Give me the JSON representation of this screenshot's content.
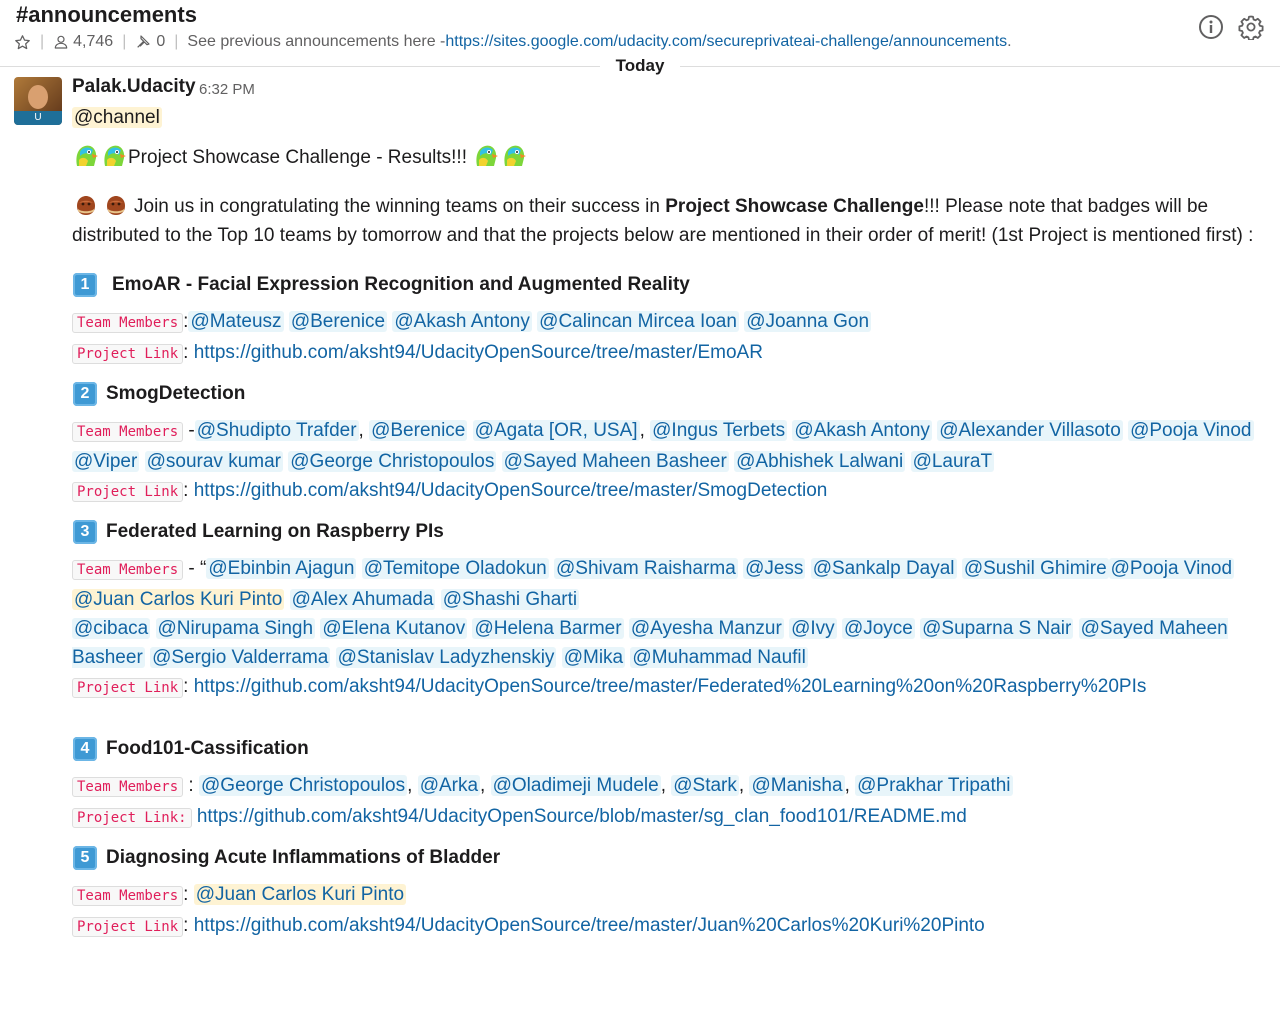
{
  "header": {
    "channel_name": "#announcements",
    "member_count": "4,746",
    "pinned_count": "0",
    "topic_text": "See previous announcements here - ",
    "topic_link": "https://sites.google.com/udacity.com/secureprivateai-challenge/announcements",
    "topic_suffix": ".",
    "icons": [
      "star-icon",
      "person-icon",
      "pin-icon",
      "info-icon",
      "gear-icon"
    ]
  },
  "day_divider": "Today",
  "message": {
    "sender": "Palak.Udacity",
    "time": "6:32 PM",
    "channel_mention": "@channel",
    "heading": "Project Showcase Challenge - Results!!!",
    "intro_before": "Join us in congratulating the winning teams on their success in ",
    "intro_bold": "Project Showcase Challenge",
    "intro_after": "!!! Please note that badges will be distributed to the Top 10 teams by tomorrow and that the projects below are mentioned in their order of merit! (1st Project is mentioned first) :",
    "team_label": "Team Members",
    "link_label": "Project Link",
    "link_label_colon": "Project Link:",
    "projects": [
      {
        "number": "1",
        "title": "EmoAR - Facial Expression Recognition and Augmented Reality",
        "members": [
          "@Mateusz",
          "@Berenice",
          "@Akash Antony",
          "@Calincan Mircea Ioan",
          "@Joanna Gon"
        ],
        "link": "https://github.com/aksht94/UdacityOpenSource/tree/master/EmoAR"
      },
      {
        "number": "2",
        "title": "SmogDetection",
        "members": [
          "@Shudipto Trafder",
          "@Berenice",
          "@Agata [OR, USA]",
          "@Ingus Terbets",
          "@Akash Antony",
          "@Alexander Villasoto",
          "@Pooja Vinod",
          "@Viper",
          "@sourav kumar",
          "@George Christopoulos",
          "@Sayed Maheen Basheer",
          "@Abhishek Lalwani",
          "@LauraT"
        ],
        "link": "https://github.com/aksht94/UdacityOpenSource/tree/master/SmogDetection"
      },
      {
        "number": "3",
        "title": "Federated Learning on Raspberry PIs",
        "members": [
          "@Ebinbin Ajagun",
          "@Temitope Oladokun",
          "@Shivam Raisharma",
          "@Jess",
          "@Sankalp Dayal",
          "@Sushil Ghimire",
          "@Pooja Vinod",
          "@Juan Carlos Kuri Pinto",
          "@Alex Ahumada",
          "@Shashi Gharti",
          "@cibaca",
          "@Nirupama Singh",
          "@Elena Kutanov",
          "@Helena Barmer",
          "@Ayesha Manzur",
          "@Ivy",
          "@Joyce",
          "@Suparna S Nair",
          "@Sayed Maheen Basheer",
          "@Sergio Valderrama",
          "@Stanislav Ladyzhenskiy",
          "@Mika",
          "@Muhammad Naufil"
        ],
        "link": "https://github.com/aksht94/UdacityOpenSource/tree/master/Federated%20Learning%20on%20Raspberry%20PIs"
      },
      {
        "number": "4",
        "title": "Food101-Cassification",
        "members": [
          "@George Christopoulos",
          "@Arka",
          "@Oladimeji Mudele",
          "@Stark",
          "@Manisha",
          "@Prakhar Tripathi"
        ],
        "link": "https://github.com/aksht94/UdacityOpenSource/blob/master/sg_clan_food101/README.md"
      },
      {
        "number": "5",
        "title": "Diagnosing Acute Inflammations of Bladder",
        "members": [
          "@Juan Carlos Kuri Pinto"
        ],
        "link": "https://github.com/aksht94/UdacityOpenSource/tree/master/Juan%20Carlos%20Kuri%20Pinto"
      }
    ]
  },
  "colors": {
    "link": "#1264a3",
    "mention_bg": "#e8f5fa",
    "self_mention_bg": "#fef3d3",
    "code_text": "#e01e5a",
    "number_badge": "#3e99d4"
  }
}
